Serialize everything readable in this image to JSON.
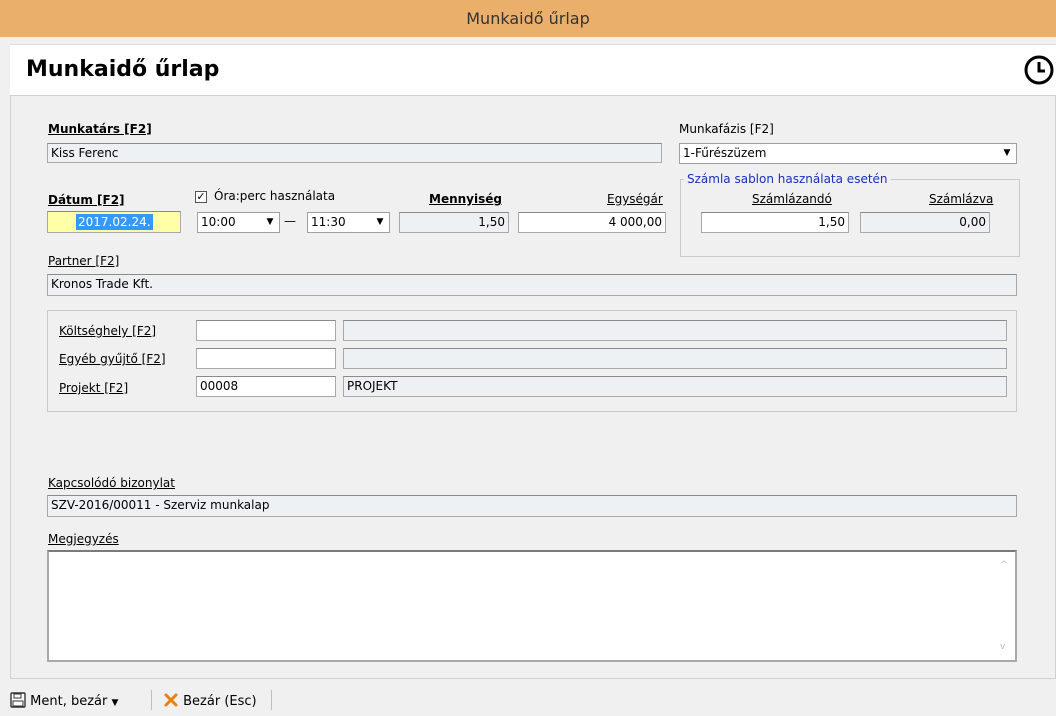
{
  "window": {
    "title": "Munkaidő űrlap"
  },
  "header": {
    "title": "Munkaidő űrlap",
    "icon": "clock-icon"
  },
  "form": {
    "munkatars": {
      "label": "Munkatárs [F2]",
      "value": "Kiss Ferenc"
    },
    "munkafazis": {
      "label": "Munkafázis [F2]",
      "value": "1-Fűrészüzem"
    },
    "datum": {
      "label": "Dátum [F2]",
      "value": "2017.02.24."
    },
    "ora_perc": {
      "label": "Óra:perc használata",
      "checked": true,
      "check_glyph": "✓"
    },
    "time_from": {
      "value": "10:00"
    },
    "time_separator": "—",
    "time_to": {
      "value": "11:30"
    },
    "mennyiseg": {
      "label": "Mennyiség",
      "value": "1,50"
    },
    "egysegar": {
      "label": "Egységár",
      "value": "4 000,00"
    },
    "szamla_group": {
      "title": "Számla sablon használata esetén",
      "szamlazando": {
        "label": "Számlázandó",
        "value": "1,50"
      },
      "szamlazva": {
        "label": "Számlázva",
        "value": "0,00"
      }
    },
    "partner": {
      "label": "Partner [F2]",
      "value": "Kronos Trade Kft."
    },
    "koltseghely": {
      "label": "Költséghely [F2]",
      "code": "",
      "name": ""
    },
    "egyeb_gyujto": {
      "label": "Egyéb gyűjtő [F2]",
      "code": "",
      "name": ""
    },
    "projekt": {
      "label": "Projekt [F2]",
      "code": "00008",
      "name": "PROJEKT"
    },
    "kapcsolodo": {
      "label": "Kapcsolódó bizonylat",
      "value": "SZV-2016/00011 - Szerviz munkalap"
    },
    "megjegyzes": {
      "label": "Megjegyzés",
      "value": ""
    }
  },
  "toolbar": {
    "save_label": "Ment, bezár",
    "close_label": "Bezár (Esc)"
  },
  "glyphs": {
    "dropdown": "▼",
    "scroll_up": "^",
    "scroll_down": "v"
  },
  "colors": {
    "titlebar": "#eab06b",
    "group_title": "#1a2fc0",
    "selection": "#3399ff"
  }
}
